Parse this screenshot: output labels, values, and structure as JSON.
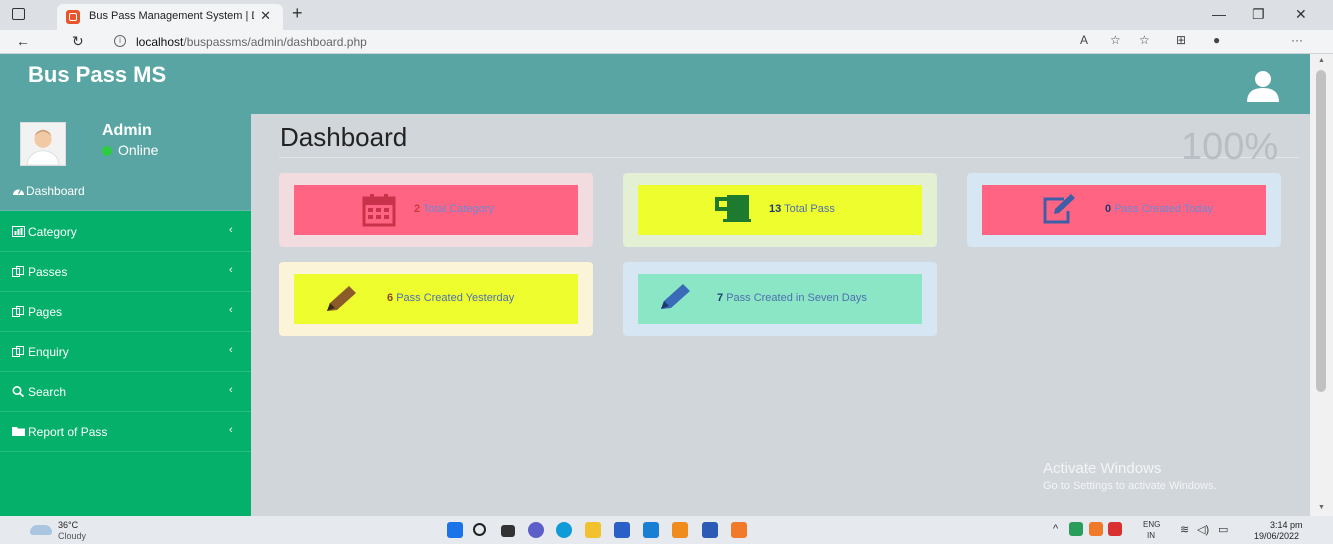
{
  "browser": {
    "tab_title": "Bus Pass Management System | D",
    "url_host": "localhost",
    "url_path": "/buspassms/admin/dashboard.php"
  },
  "app": {
    "brand": "Bus Pass MS"
  },
  "profile": {
    "name": "Admin",
    "status": "Online"
  },
  "sidebar": {
    "items": [
      {
        "label": "Dashboard",
        "icon": "dashboard-icon",
        "active": true
      },
      {
        "label": "Category",
        "icon": "chart-icon"
      },
      {
        "label": "Passes",
        "icon": "files-icon"
      },
      {
        "label": "Pages",
        "icon": "files-icon"
      },
      {
        "label": "Enquiry",
        "icon": "files-icon"
      },
      {
        "label": "Search",
        "icon": "search-icon"
      },
      {
        "label": "Report of Pass",
        "icon": "folder-icon"
      }
    ],
    "chevron": "‹"
  },
  "page": {
    "title": "Dashboard",
    "zoom": "100%"
  },
  "cards": [
    {
      "num": "2",
      "label": "Total Category",
      "icon": "calendar-icon",
      "bg": "#ff6582"
    },
    {
      "num": "13",
      "label": "Total Pass",
      "icon": "mug-icon",
      "bg": "#eefd2d"
    },
    {
      "num": "0",
      "label": "Pass Created Today",
      "icon": "edit-icon",
      "bg": "#ff6582"
    },
    {
      "num": "6",
      "label": "Pass Created Yesterday",
      "icon": "pencil-icon",
      "bg": "#eefd2d"
    },
    {
      "num": "7",
      "label": "Pass Created in Seven Days",
      "icon": "pencil-icon",
      "bg": "#8ae6c4"
    }
  ],
  "watermark": {
    "line1": "Activate Windows",
    "line2": "Go to Settings to activate Windows."
  },
  "taskbar": {
    "weather_temp": "36°C",
    "weather_cond": "Cloudy",
    "lang1": "ENG",
    "lang2": "IN",
    "time": "3:14 pm",
    "date": "19/06/2022"
  }
}
